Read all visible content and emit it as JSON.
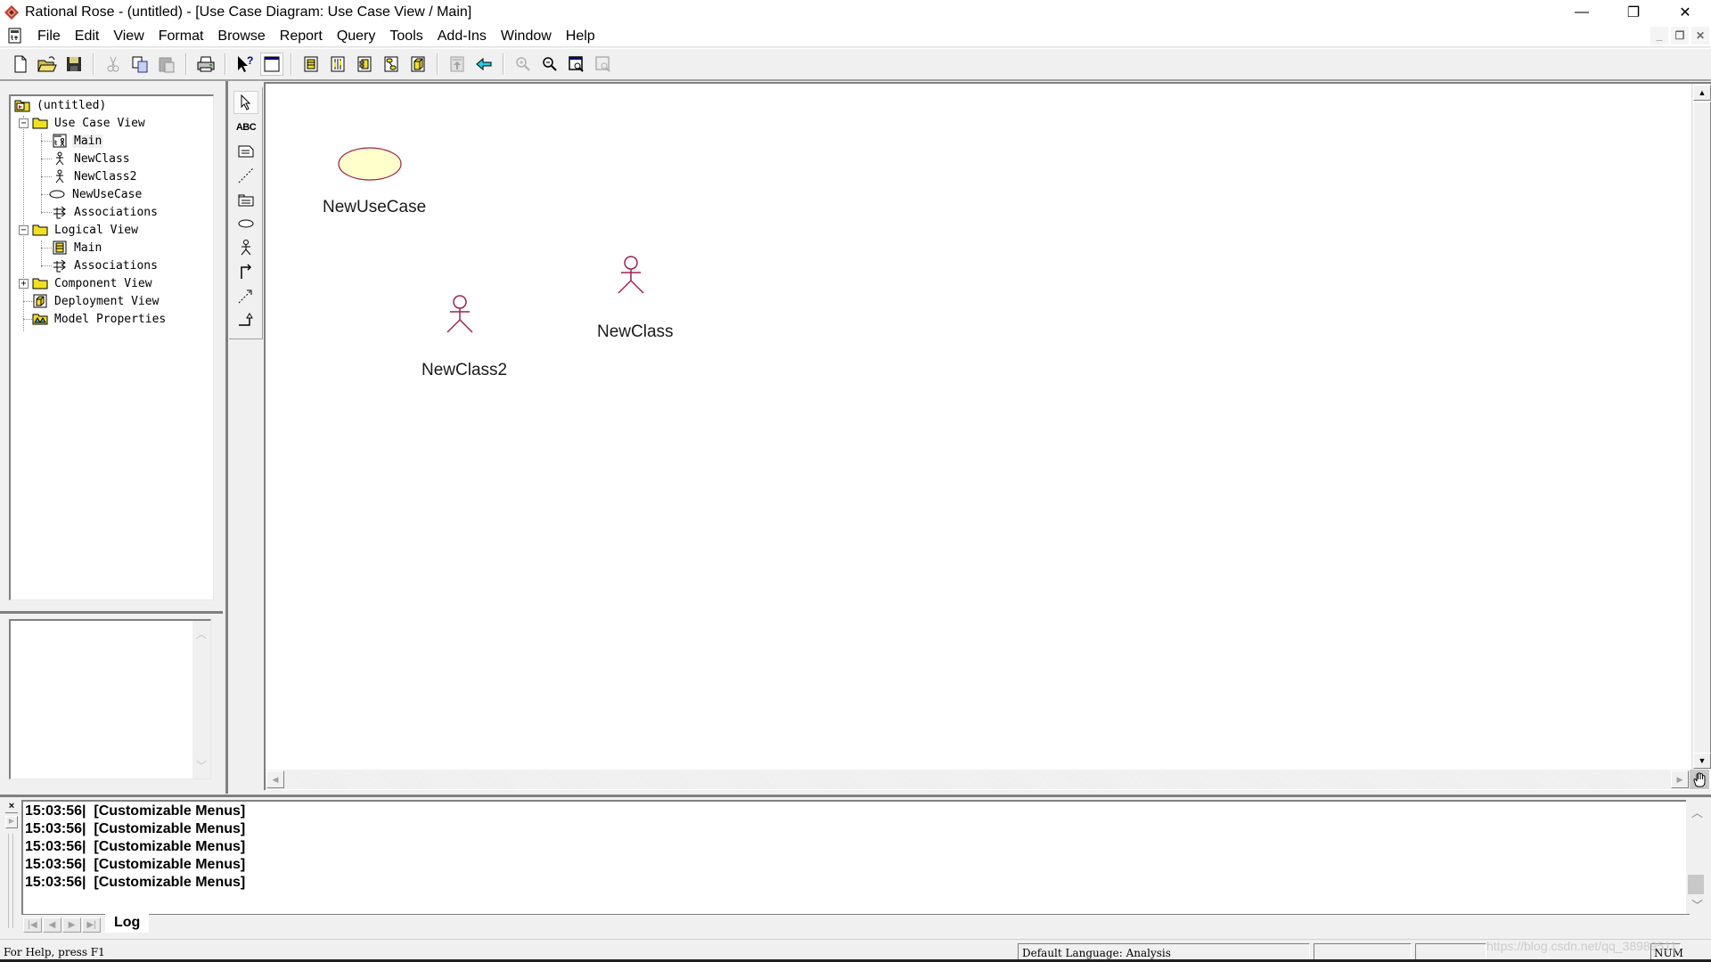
{
  "window": {
    "title": "Rational Rose - (untitled) - [Use Case Diagram: Use Case View / Main]",
    "controls": {
      "minimize": "—",
      "restore": "❐",
      "close": "✕"
    }
  },
  "menubar": {
    "items": [
      "File",
      "Edit",
      "View",
      "Format",
      "Browse",
      "Report",
      "Query",
      "Tools",
      "Add-Ins",
      "Window",
      "Help"
    ],
    "mdi_controls": {
      "minimize": "_",
      "restore": "❐",
      "close": "✕"
    }
  },
  "toolbar": {
    "buttons": [
      {
        "icon": "new-file-icon",
        "tooltip": "New"
      },
      {
        "icon": "open-folder-icon",
        "tooltip": "Open"
      },
      {
        "icon": "save-icon",
        "tooltip": "Save"
      },
      {
        "icon": "cut-icon",
        "tooltip": "Cut"
      },
      {
        "icon": "copy-icon",
        "tooltip": "Copy"
      },
      {
        "icon": "paste-icon",
        "tooltip": "Paste"
      },
      {
        "icon": "print-icon",
        "tooltip": "Print"
      },
      {
        "icon": "context-help-icon",
        "tooltip": "Context Sensitive Help"
      },
      {
        "icon": "view-documentation-icon",
        "tooltip": "View Documentation"
      },
      {
        "icon": "browse-class-diagram-icon",
        "tooltip": "Browse Class Diagram"
      },
      {
        "icon": "browse-interaction-diagram-icon",
        "tooltip": "Browse Interaction Diagram"
      },
      {
        "icon": "browse-component-diagram-icon",
        "tooltip": "Browse Component Diagram"
      },
      {
        "icon": "browse-state-diagram-icon",
        "tooltip": "Browse State Machine Diagram"
      },
      {
        "icon": "browse-deployment-diagram-icon",
        "tooltip": "Browse Deployment Diagram"
      },
      {
        "icon": "browse-parent-icon",
        "tooltip": "Browse Parent"
      },
      {
        "icon": "browse-previous-icon",
        "tooltip": "Browse Previous Diagram"
      },
      {
        "icon": "zoom-in-icon",
        "tooltip": "Zoom In"
      },
      {
        "icon": "zoom-out-icon",
        "tooltip": "Zoom Out"
      },
      {
        "icon": "fit-in-window-icon",
        "tooltip": "Fit in Window"
      },
      {
        "icon": "undo-fit-icon",
        "tooltip": "Undo Fit in Window"
      }
    ]
  },
  "browser": {
    "tree": [
      {
        "label": "(untitled)",
        "icon": "model-icon",
        "level": 0
      },
      {
        "label": "Use Case View",
        "icon": "folder-icon",
        "level": 1,
        "expanded": true
      },
      {
        "label": "Main",
        "icon": "use-case-diagram-icon",
        "level": 2,
        "selected": true
      },
      {
        "label": "NewClass",
        "icon": "actor-icon",
        "level": 2
      },
      {
        "label": "NewClass2",
        "icon": "actor-icon",
        "level": 2
      },
      {
        "label": "NewUseCase",
        "icon": "use-case-icon",
        "level": 2
      },
      {
        "label": "Associations",
        "icon": "associations-icon",
        "level": 2
      },
      {
        "label": "Logical View",
        "icon": "folder-icon",
        "level": 1,
        "expanded": true
      },
      {
        "label": "Main",
        "icon": "class-diagram-icon",
        "level": 2
      },
      {
        "label": "Associations",
        "icon": "associations-icon",
        "level": 2
      },
      {
        "label": "Component View",
        "icon": "folder-icon",
        "level": 1,
        "expanded": false
      },
      {
        "label": "Deployment View",
        "icon": "deployment-icon",
        "level": 1
      },
      {
        "label": "Model Properties",
        "icon": "model-properties-icon",
        "level": 1
      }
    ]
  },
  "toolbox": {
    "tools": [
      {
        "icon": "selection-arrow-icon",
        "active": true
      },
      {
        "icon": "text-box-icon",
        "text": "ABC"
      },
      {
        "icon": "note-icon"
      },
      {
        "icon": "anchor-note-icon"
      },
      {
        "icon": "package-icon"
      },
      {
        "icon": "use-case-tool-icon"
      },
      {
        "icon": "actor-tool-icon"
      },
      {
        "icon": "unidirectional-association-icon"
      },
      {
        "icon": "dependency-icon"
      },
      {
        "icon": "generalization-icon"
      }
    ]
  },
  "diagram": {
    "use_cases": [
      {
        "name": "NewUseCase"
      }
    ],
    "actors": [
      {
        "name": "NewClass"
      },
      {
        "name": "NewClass2"
      }
    ],
    "colors": {
      "element_stroke": "#a0224a",
      "use_case_fill": "#ffffcc"
    }
  },
  "log": {
    "entries": [
      {
        "time": "15:03:56|",
        "message": "[Customizable Menus]"
      },
      {
        "time": "15:03:56|",
        "message": "[Customizable Menus]"
      },
      {
        "time": "15:03:56|",
        "message": "[Customizable Menus]"
      },
      {
        "time": "15:03:56|",
        "message": "[Customizable Menus]"
      },
      {
        "time": "15:03:56|",
        "message": "[Customizable Menus]"
      }
    ],
    "tab": "Log",
    "close": "×"
  },
  "statusbar": {
    "help": "For Help, press F1",
    "language": "Default Language: Analysis",
    "num": "NUM",
    "watermark": "https://blog.csdn.net/qq_38989511"
  }
}
